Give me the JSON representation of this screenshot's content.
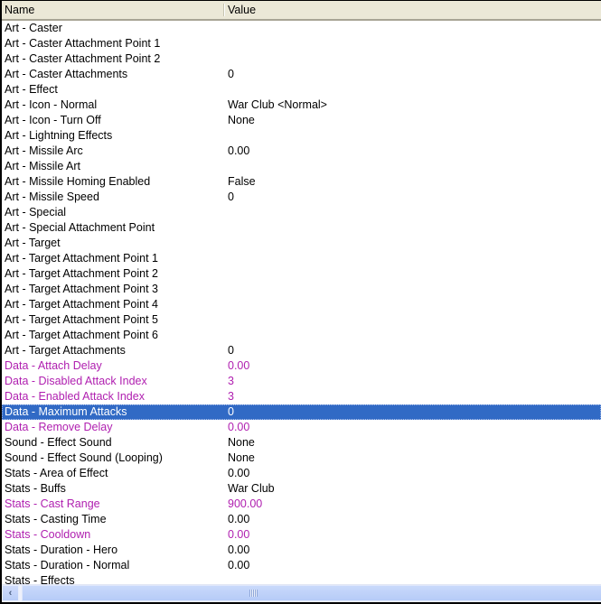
{
  "columns": {
    "name": "Name",
    "value": "Value"
  },
  "colors": {
    "modified_text": "#b020b0",
    "selection_bg": "#316ac5",
    "header_bg": "#ebe8d7"
  },
  "rows": [
    {
      "name": "Art - Caster",
      "value": "",
      "modified": false,
      "selected": false
    },
    {
      "name": "Art - Caster Attachment Point 1",
      "value": "",
      "modified": false,
      "selected": false
    },
    {
      "name": "Art - Caster Attachment Point 2",
      "value": "",
      "modified": false,
      "selected": false
    },
    {
      "name": "Art - Caster Attachments",
      "value": "0",
      "modified": false,
      "selected": false
    },
    {
      "name": "Art - Effect",
      "value": "",
      "modified": false,
      "selected": false
    },
    {
      "name": "Art - Icon - Normal",
      "value": "War Club <Normal>",
      "modified": false,
      "selected": false
    },
    {
      "name": "Art - Icon - Turn Off",
      "value": "None",
      "modified": false,
      "selected": false
    },
    {
      "name": "Art - Lightning Effects",
      "value": "",
      "modified": false,
      "selected": false
    },
    {
      "name": "Art - Missile Arc",
      "value": "0.00",
      "modified": false,
      "selected": false
    },
    {
      "name": "Art - Missile Art",
      "value": "",
      "modified": false,
      "selected": false
    },
    {
      "name": "Art - Missile Homing Enabled",
      "value": "False",
      "modified": false,
      "selected": false
    },
    {
      "name": "Art - Missile Speed",
      "value": "0",
      "modified": false,
      "selected": false
    },
    {
      "name": "Art - Special",
      "value": "",
      "modified": false,
      "selected": false
    },
    {
      "name": "Art - Special Attachment Point",
      "value": "",
      "modified": false,
      "selected": false
    },
    {
      "name": "Art - Target",
      "value": "",
      "modified": false,
      "selected": false
    },
    {
      "name": "Art - Target Attachment Point 1",
      "value": "",
      "modified": false,
      "selected": false
    },
    {
      "name": "Art - Target Attachment Point 2",
      "value": "",
      "modified": false,
      "selected": false
    },
    {
      "name": "Art - Target Attachment Point 3",
      "value": "",
      "modified": false,
      "selected": false
    },
    {
      "name": "Art - Target Attachment Point 4",
      "value": "",
      "modified": false,
      "selected": false
    },
    {
      "name": "Art - Target Attachment Point 5",
      "value": "",
      "modified": false,
      "selected": false
    },
    {
      "name": "Art - Target Attachment Point 6",
      "value": "",
      "modified": false,
      "selected": false
    },
    {
      "name": "Art - Target Attachments",
      "value": "0",
      "modified": false,
      "selected": false
    },
    {
      "name": "Data - Attach Delay",
      "value": "0.00",
      "modified": true,
      "selected": false
    },
    {
      "name": "Data - Disabled Attack Index",
      "value": "3",
      "modified": true,
      "selected": false
    },
    {
      "name": "Data - Enabled Attack Index",
      "value": "3",
      "modified": true,
      "selected": false
    },
    {
      "name": "Data - Maximum Attacks",
      "value": "0",
      "modified": true,
      "selected": true
    },
    {
      "name": "Data - Remove Delay",
      "value": "0.00",
      "modified": true,
      "selected": false
    },
    {
      "name": "Sound - Effect Sound",
      "value": "None",
      "modified": false,
      "selected": false
    },
    {
      "name": "Sound - Effect Sound (Looping)",
      "value": "None",
      "modified": false,
      "selected": false
    },
    {
      "name": "Stats - Area of Effect",
      "value": "0.00",
      "modified": false,
      "selected": false
    },
    {
      "name": "Stats - Buffs",
      "value": "War Club",
      "modified": false,
      "selected": false
    },
    {
      "name": "Stats - Cast Range",
      "value": "900.00",
      "modified": true,
      "selected": false
    },
    {
      "name": "Stats - Casting Time",
      "value": "0.00",
      "modified": false,
      "selected": false
    },
    {
      "name": "Stats - Cooldown",
      "value": "0.00",
      "modified": true,
      "selected": false
    },
    {
      "name": "Stats - Duration - Hero",
      "value": "0.00",
      "modified": false,
      "selected": false
    },
    {
      "name": "Stats - Duration - Normal",
      "value": "0.00",
      "modified": false,
      "selected": false
    },
    {
      "name": "Stats - Effects",
      "value": "",
      "modified": false,
      "selected": false
    }
  ],
  "scrollbar": {
    "left_arrow_icon": "chevron-left-icon",
    "left_arrow_glyph": "‹",
    "position": 0.0
  }
}
